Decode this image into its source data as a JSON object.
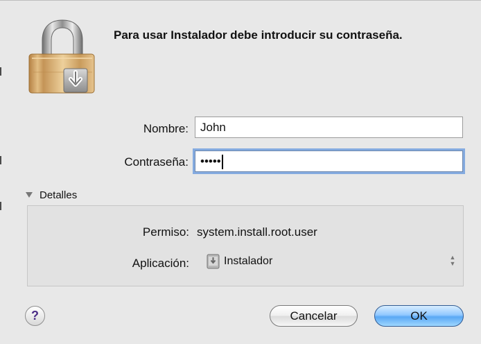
{
  "dialog": {
    "message": "Para usar Instalador debe introducir su contraseña.",
    "lock_icon": "lock-installer-icon"
  },
  "form": {
    "name_label": "Nombre:",
    "name_value": "John",
    "password_label": "Contraseña:",
    "password_value": "•••••"
  },
  "details": {
    "toggle_label": "Detalles",
    "permission_label": "Permiso:",
    "permission_value": "system.install.root.user",
    "application_label": "Aplicación:",
    "application_value": "Instalador",
    "application_icon": "installer-icon"
  },
  "buttons": {
    "help": "?",
    "cancel": "Cancelar",
    "ok": "OK"
  }
}
